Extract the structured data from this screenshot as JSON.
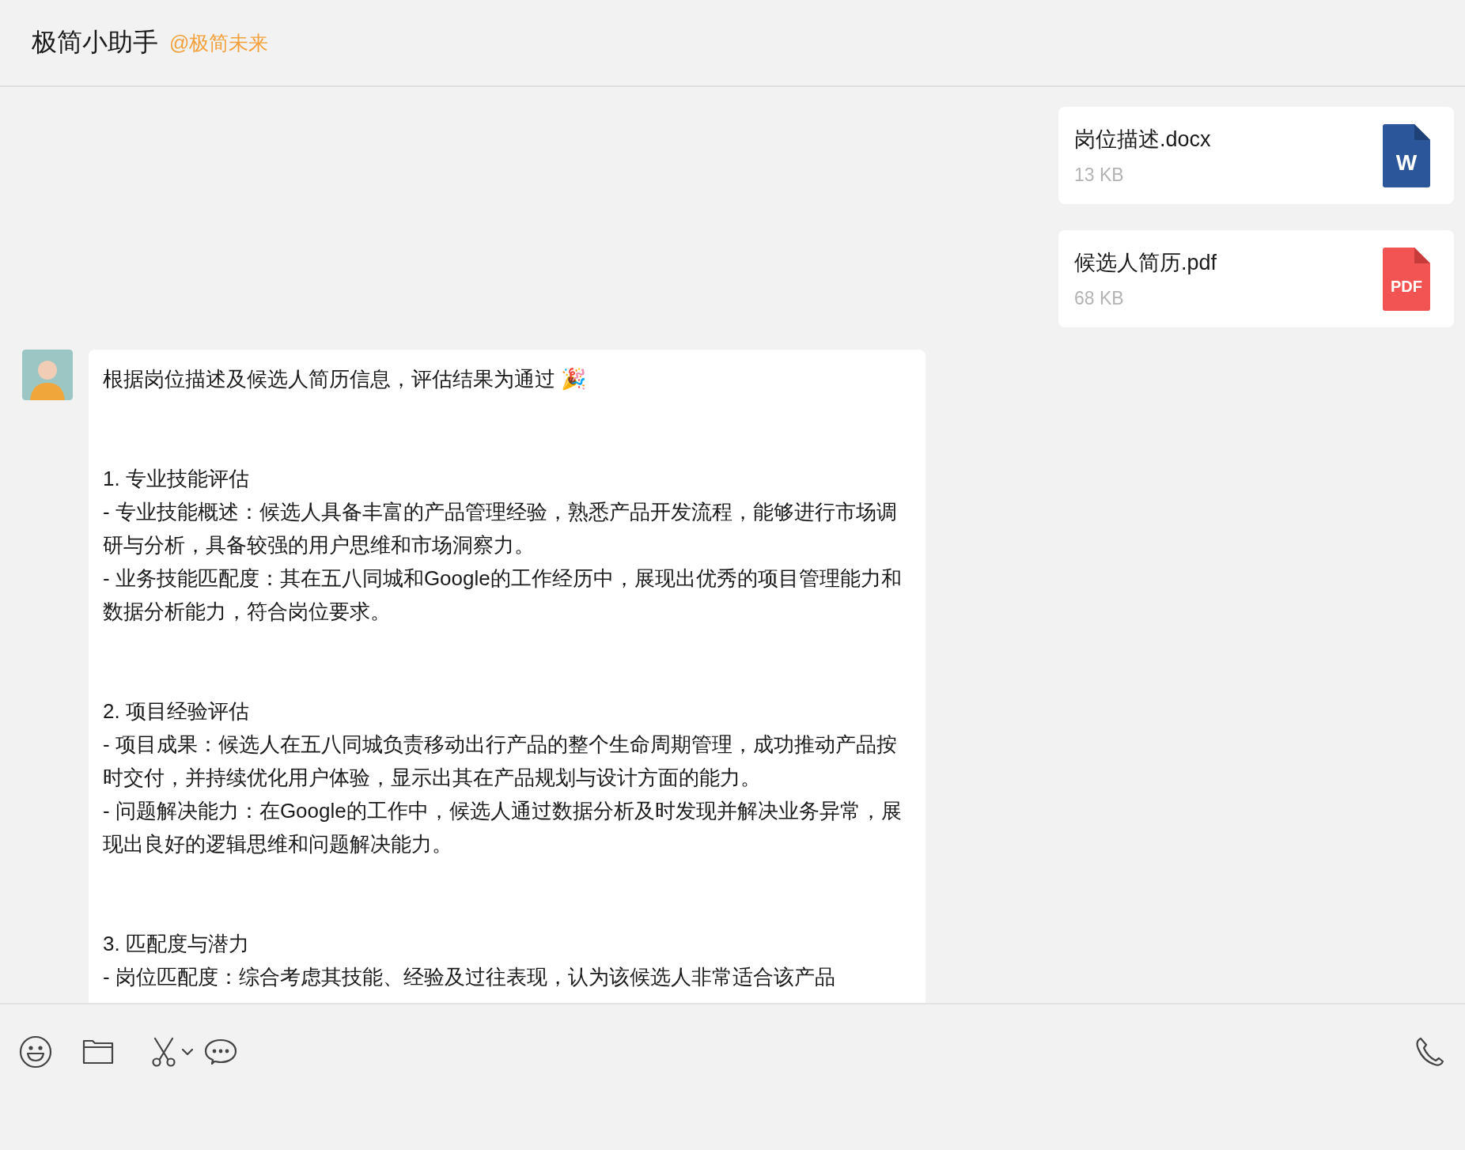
{
  "header": {
    "title": "极简小助手",
    "mention": "@极简未来"
  },
  "files": [
    {
      "name": "岗位描述.docx",
      "size": "13 KB",
      "kind": "word",
      "icon_label": "W"
    },
    {
      "name": "候选人简历.pdf",
      "size": "68 KB",
      "kind": "pdf",
      "icon_label": "PDF"
    }
  ],
  "reply": {
    "intro": "根据岗位描述及候选人简历信息，评估结果为通过 🎉",
    "sections": [
      {
        "heading": "1. 专业技能评估",
        "items": [
          "- 专业技能概述：候选人具备丰富的产品管理经验，熟悉产品开发流程，能够进行市场调研与分析，具备较强的用户思维和市场洞察力。",
          "- 业务技能匹配度：其在五八同城和Google的工作经历中，展现出优秀的项目管理能力和数据分析能力，符合岗位要求。"
        ]
      },
      {
        "heading": "2. 项目经验评估",
        "items": [
          "- 项目成果：候选人在五八同城负责移动出行产品的整个生命周期管理，成功推动产品按时交付，并持续优化用户体验，显示出其在产品规划与设计方面的能力。",
          "- 问题解决能力：在Google的工作中，候选人通过数据分析及时发现并解决业务异常，展现出良好的逻辑思维和问题解决能力。"
        ]
      },
      {
        "heading": "3. 匹配度与潜力",
        "items": [
          "- 岗位匹配度：综合考虑其技能、经验及过往表现，认为该候选人非常适合该产品"
        ]
      }
    ]
  }
}
